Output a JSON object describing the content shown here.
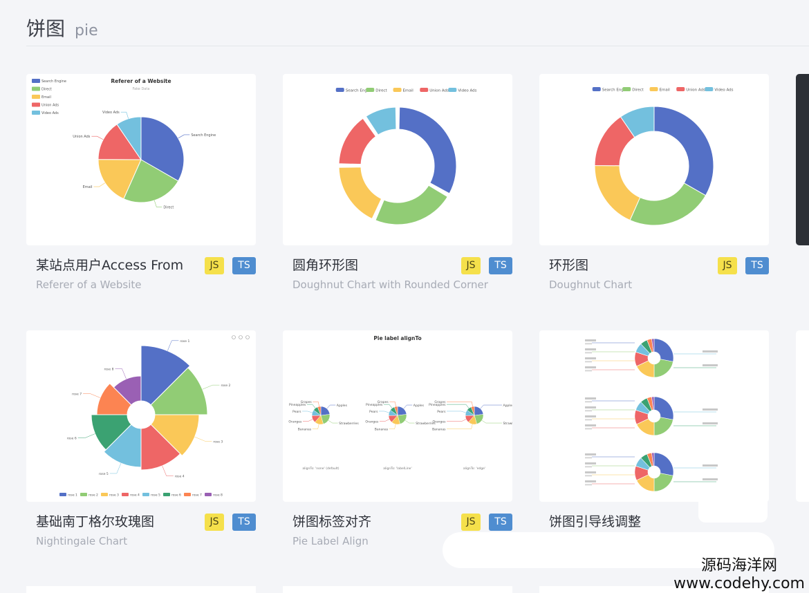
{
  "header": {
    "title_cn": "饼图",
    "title_en": "pie"
  },
  "badges": {
    "js": "JS",
    "ts": "TS"
  },
  "palette": [
    "#5470c6",
    "#91cc75",
    "#fac858",
    "#ee6666",
    "#73c0de",
    "#3ba272",
    "#fc8452",
    "#9a60b4"
  ],
  "cards": [
    {
      "title": "某站点用户Access From",
      "subtitle": "Referer of a Website",
      "thumb": {
        "chart_title": "Referer of a Website",
        "chart_subtitle": "Fake Data",
        "legend": [
          "Search Engine",
          "Direct",
          "Email",
          "Union Ads",
          "Video Ads"
        ],
        "labels": [
          "Search Engine",
          "Direct",
          "Email",
          "Union Ads",
          "Video Ads"
        ],
        "values": [
          1048,
          735,
          580,
          484,
          300
        ]
      }
    },
    {
      "title": "圆角环形图",
      "subtitle": "Doughnut Chart with Rounded Corner",
      "thumb": {
        "legend": [
          "Search Engine",
          "Direct",
          "Email",
          "Union Ads",
          "Video Ads"
        ],
        "values": [
          1048,
          735,
          580,
          484,
          300
        ]
      }
    },
    {
      "title": "环形图",
      "subtitle": "Doughnut Chart",
      "thumb": {
        "legend": [
          "Search Engine",
          "Direct",
          "Email",
          "Union Ads",
          "Video Ads"
        ],
        "values": [
          1048,
          735,
          580,
          484,
          300
        ]
      }
    },
    {
      "title": "基础南丁格尔玫瑰图",
      "subtitle": "Nightingale Chart",
      "thumb": {
        "labels": [
          "rose 1",
          "rose 2",
          "rose 3",
          "rose 4",
          "rose 5",
          "rose 6",
          "rose 7",
          "rose 8"
        ],
        "values": [
          40,
          38,
          32,
          30,
          28,
          26,
          22,
          18
        ]
      }
    },
    {
      "title": "饼图标签对齐",
      "subtitle": "Pie Label Align",
      "thumb": {
        "chart_title": "Pie label alignTo",
        "captions": [
          "alignTo: 'none' (default)",
          "alignTo: 'labelLine'",
          "alignTo: 'edge'"
        ],
        "labels": [
          "Apples",
          "Strawberries",
          "Bananas",
          "Oranges",
          "Pears",
          "Pineapples",
          "Grapes"
        ],
        "values": [
          70,
          68,
          48,
          40,
          32,
          27,
          18
        ]
      }
    },
    {
      "title": "饼图引导线调整",
      "subtitle": "",
      "thumb": {}
    }
  ],
  "watermark": {
    "line1": "源码海洋网",
    "line2": "www.codehy.com"
  }
}
